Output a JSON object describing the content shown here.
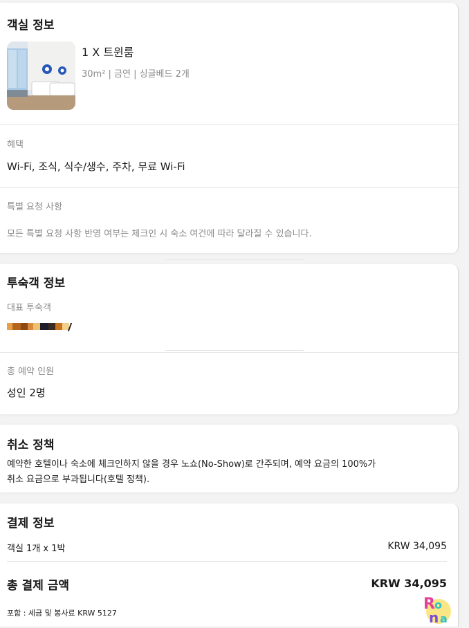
{
  "room_info": {
    "title": "객실 정보",
    "room_name": "1 X 트윈룸",
    "room_details": "30m² | 금연 | 싱글베드 2개",
    "photo_icon": "hotel-room-photo"
  },
  "benefits": {
    "label": "혜택",
    "value": "Wi-Fi, 조식, 식수/생수, 주차, 무료 Wi-Fi"
  },
  "special_request": {
    "label": "특별 요청 사항",
    "note": "모든 특별 요청 사항 반영 여부는 체크인 시 숙소 여건에 따라 달라질 수 있습니다."
  },
  "guest_info": {
    "title": "투숙객 정보",
    "lead_guest_label": "대표 투숙객",
    "total_guests_label": "총 예약 인원",
    "total_guests_value": "성인 2명"
  },
  "cancellation": {
    "title": "취소 정책",
    "text_line1": "예약한 호텔이나 숙소에 체크인하지 않을 경우 노쇼(No-Show)로 간주되며, 예약 요금의 100%가",
    "text_line2": "취소 요금으로 부과됩니다(호텔 정책)."
  },
  "payment": {
    "title": "결제 정보",
    "room_line_label": "객실 1개 x 1박",
    "room_line_amount": "KRW 34,095",
    "total_label": "총 결제 금액",
    "total_amount": "KRW 34,095",
    "tax_note": "포함 : 세금 및 봉사료 KRW 5127"
  },
  "colors": {
    "accent_text": "#1a1a1a",
    "muted_text": "#8a8a8a",
    "logo_pink": "#e4409a",
    "logo_yellow": "#f5d21f",
    "logo_teal": "#2ec2c9",
    "logo_purple": "#7a4dd6"
  },
  "icons": {
    "logo": "watermark-logo-icon"
  }
}
